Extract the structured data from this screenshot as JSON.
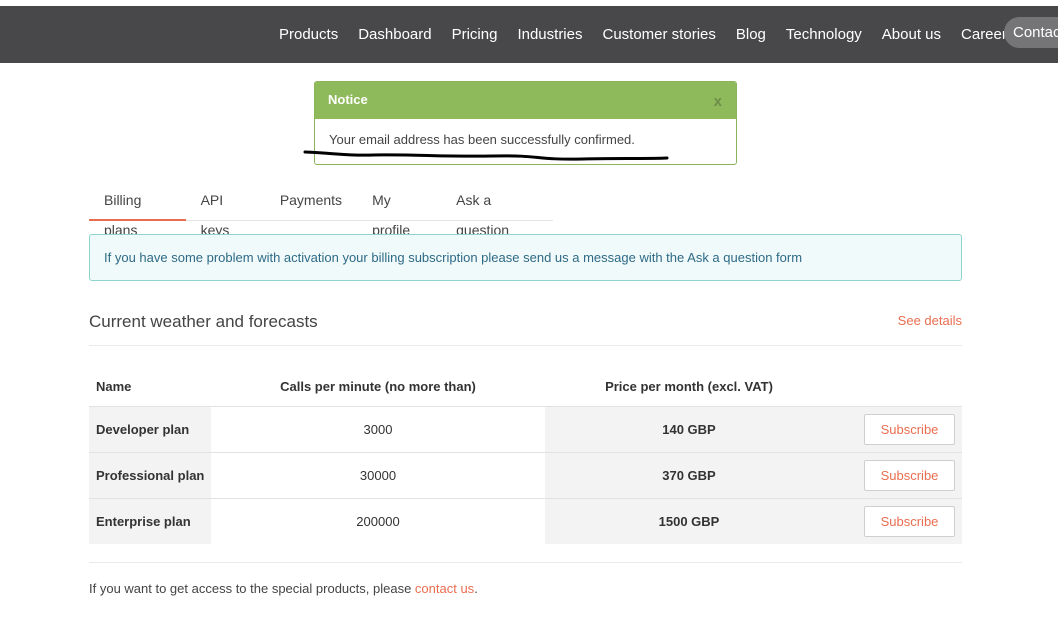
{
  "nav": {
    "items": [
      "Products",
      "Dashboard",
      "Pricing",
      "Industries",
      "Customer stories",
      "Blog",
      "Technology",
      "About us",
      "Careers"
    ],
    "contact_label": "Contac"
  },
  "notice": {
    "title": "Notice",
    "close_label": "x",
    "message": "Your email address has been successfully confirmed."
  },
  "tabs": [
    "Billing plans",
    "API keys",
    "Payments",
    "My profile",
    "Ask a question"
  ],
  "info_message": "If you have some problem with activation your billing subscription please send us a message with the Ask a question form",
  "section": {
    "title": "Current weather and forecasts",
    "details_label": "See details"
  },
  "table": {
    "headers": [
      "Name",
      "Calls per minute (no more than)",
      "Price per month (excl. VAT)"
    ],
    "rows": [
      {
        "name": "Developer plan",
        "calls": "3000",
        "price": "140 GBP",
        "button": "Subscribe"
      },
      {
        "name": "Professional plan",
        "calls": "30000",
        "price": "370 GBP",
        "button": "Subscribe"
      },
      {
        "name": "Enterprise plan",
        "calls": "200000",
        "price": "1500 GBP",
        "button": "Subscribe"
      }
    ]
  },
  "footer": {
    "text": "If you want to get access to the special products, please ",
    "link": "contact us",
    "end": "."
  },
  "colors": {
    "nav_bg": "#48484a",
    "notice_green": "#8fba5b",
    "accent": "#e96e50",
    "info_border": "#8fd3cf"
  }
}
